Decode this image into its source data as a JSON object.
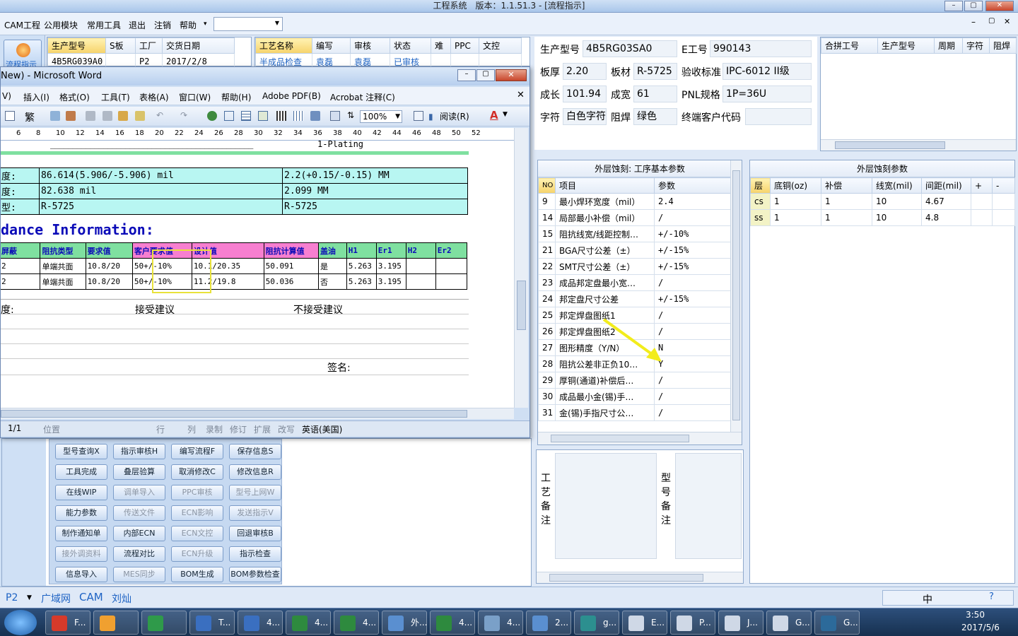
{
  "window": {
    "title": "工程系统　版本：1.1.51.3 - [流程指示]",
    "min": "–",
    "max": "▢",
    "close": "✕"
  },
  "menu": {
    "items": [
      "CAM工程",
      "公用模块",
      "常用工具",
      "退出",
      "注销",
      "帮助"
    ],
    "help_arrow": "▾",
    "dropdown_value": "",
    "mdi": [
      "–",
      "▢",
      "✕"
    ]
  },
  "left_panel": {
    "process_label": "流程指示",
    "grid_headers": [
      "生产型号",
      "S板",
      "工厂",
      "交货日期"
    ],
    "grid_row": [
      "4B5RG039A0",
      "",
      "P2",
      "2017/2/8"
    ]
  },
  "process_grid": {
    "headers": [
      "工艺名称",
      "编写",
      "审核",
      "状态",
      "难",
      "PPC",
      "文控"
    ],
    "row": [
      "半成品检查",
      "袁磊",
      "袁磊",
      "已审核",
      "",
      "",
      ""
    ]
  },
  "info": {
    "prod_model_label": "生产型号",
    "prod_model": "4B5RG03SA0",
    "ework_label": "E工号",
    "ework": "990143",
    "thickness_label": "板厚",
    "thickness": "2.20",
    "material_label": "板材",
    "material": "R-5725",
    "accept_label": "验收标准",
    "accept": "IPC-6012 II级",
    "length_label": "成长",
    "length": "101.94",
    "width_label": "成宽",
    "width": "61",
    "pnl_label": "PNL规格",
    "pnl": "1P=36U",
    "char_label": "字符",
    "char": "白色字符",
    "mask_label": "阻焊",
    "mask": "绿色",
    "customer_label": "终端客户代码",
    "customer": ""
  },
  "merge_grid": {
    "headers": [
      "合拼工号",
      "生产型号",
      "周期",
      "字符",
      "阻焊"
    ]
  },
  "etch_basic": {
    "title": "外层蚀刻: 工序基本参数",
    "headers": [
      "NO",
      "项目",
      "参数"
    ],
    "rows": [
      [
        "9",
        "最小焊环宽度（mil）",
        "2.4"
      ],
      [
        "14",
        "局部最小补偿（mil）",
        "/"
      ],
      [
        "15",
        "阻抗线宽/线距控制…",
        "+/-10%"
      ],
      [
        "21",
        "BGA尺寸公差（±）",
        "+/-15%"
      ],
      [
        "22",
        "SMT尺寸公差（±）",
        "+/-15%"
      ],
      [
        "23",
        "成品邦定盘最小宽…",
        "/"
      ],
      [
        "24",
        "邦定盘尺寸公差",
        "+/-15%"
      ],
      [
        "25",
        "邦定焊盘图纸1",
        "/"
      ],
      [
        "26",
        "邦定焊盘图纸2",
        "/"
      ],
      [
        "27",
        "图形精度（Y/N）",
        "N"
      ],
      [
        "28",
        "阻抗公差非正负10…",
        "Y"
      ],
      [
        "29",
        "厚铜(通道)补偿后…",
        "/"
      ],
      [
        "30",
        "成品最小金(锡)手…",
        "/"
      ],
      [
        "31",
        "金(锡)手指尺寸公…",
        "/"
      ]
    ]
  },
  "etch_params": {
    "title": "外层蚀刻参数",
    "headers": [
      "层",
      "底铜(oz)",
      "补偿",
      "线宽(mil)",
      "间距(mil)",
      "+",
      "-"
    ],
    "rows": [
      [
        "cs",
        "1",
        "1",
        "10",
        "4.67",
        "",
        ""
      ],
      [
        "ss",
        "1",
        "1",
        "10",
        "4.8",
        "",
        ""
      ]
    ]
  },
  "remarks": {
    "process_label": "工艺备注",
    "model_label": "型号备注",
    "process_text": "",
    "model_text": ""
  },
  "buttons": [
    [
      "型号查询X",
      "指示审核H",
      "编写流程F",
      "保存信息S"
    ],
    [
      "工具完成",
      "叠层验算",
      "取消修改C",
      "修改信息R"
    ],
    [
      "在线WIP",
      "调单导入",
      "PPC审核",
      "型号上网W"
    ],
    [
      "能力参数",
      "传送文件",
      "ECN影响",
      "发送指示V"
    ],
    [
      "制作通知单",
      "内部ECN",
      "ECN文控",
      "回退审核B"
    ],
    [
      "接外调资料",
      "流程对比",
      "ECN升级",
      "指示检查"
    ],
    [
      "信息导入",
      "MES同步",
      "BOM生成",
      "BOM参数检查"
    ]
  ],
  "disabled_buttons": [
    "调单导入",
    "PPC审核",
    "型号上网W",
    "传送文件",
    "ECN影响",
    "发送指示V",
    "ECN文控",
    "接外调资料",
    "ECN升级",
    "MES同步"
  ],
  "word": {
    "title": "New) - Microsoft Word",
    "menu": [
      "V)",
      "插入(I)",
      "格式(O)",
      "工具(T)",
      "表格(A)",
      "窗口(W)",
      "帮助(H)",
      "Adobe PDF(B)",
      "Acrobat 注释(C)"
    ],
    "zoom": "100%",
    "read_btn": "阅读(R)",
    "trad": "繁",
    "ruler": [
      "6",
      "8",
      "10",
      "12",
      "14",
      "16",
      "18",
      "20",
      "22",
      "24",
      "26",
      "28",
      "30",
      "32",
      "34",
      "36",
      "38",
      "40",
      "42",
      "44",
      "46",
      "48",
      "50",
      "52"
    ],
    "plating": "1-Plating",
    "rows1": [
      [
        "度:",
        "86.614(5.906/-5.906) mil",
        "2.2(+0.15/-0.15) MM"
      ],
      [
        "度:",
        "82.638 mil",
        "2.099 MM"
      ],
      [
        "型:",
        "R-5725",
        "R-5725"
      ]
    ],
    "heading": "dance Information:",
    "imp_headers": [
      "屏蔽",
      "阻抗类型",
      "要求值",
      "客户要求值",
      "设计值",
      "阻抗计算值",
      "盖油",
      "H1",
      "Er1",
      "H2",
      "Er2"
    ],
    "imp_rows": [
      [
        "2",
        "单端共面",
        "10.8/20",
        "50+/-10%",
        "10.1/20.35",
        "50.091",
        "是",
        "5.263",
        "3.195",
        "",
        ""
      ],
      [
        "2",
        "单端共面",
        "10.8/20",
        "50+/-10%",
        "11.2/19.8",
        "50.036",
        "否",
        "5.263",
        "3.195",
        "",
        ""
      ]
    ],
    "advice_label": "度:",
    "accept": "接受建议",
    "reject": "不接受建议",
    "sign": "签名:",
    "status": {
      "page": "1/1",
      "pos": "位置",
      "line": "行",
      "col": "列",
      "rec": "录制",
      "rev": "修订",
      "ext": "扩展",
      "ovr": "改写",
      "lang": "英语(美国)"
    }
  },
  "bottom_tabs": {
    "factory": "P2",
    "tabs": [
      "广域网",
      "CAM",
      "刘灿"
    ]
  },
  "taskbar": {
    "items": [
      "F...",
      "",
      "",
      "T...",
      "4...",
      "4...",
      "4...",
      "外...",
      "4...",
      "4...",
      "2...",
      "g...",
      "E...",
      "P...",
      "J...",
      "G...",
      "G..."
    ],
    "time": "3:50",
    "date": "2017/5/6",
    "ime": "中"
  },
  "colors": {
    "accent": "#1e63c4",
    "highlight_box": "#e8e23a",
    "arrow": "#f2ec1c",
    "word_cyan": "#b8f6f2",
    "word_pink": "#f77fd0",
    "word_green": "#7fe0a0"
  }
}
